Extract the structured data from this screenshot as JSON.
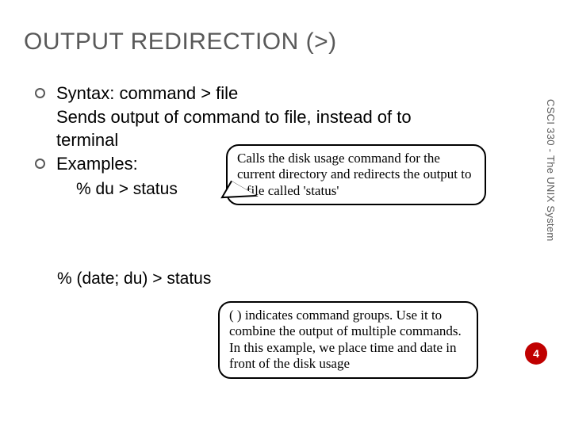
{
  "title": "OUTPUT REDIRECTION (>)",
  "bullets": {
    "syntax": "Syntax: command > file",
    "syntax_desc1": "Sends output of command to file, instead of to",
    "syntax_desc2": "terminal",
    "examples_label": "Examples:"
  },
  "examples": {
    "ex1": "% du > status",
    "ex2": "% (date; du) > status"
  },
  "callouts": {
    "c1": "Calls the disk usage command for the current directory and redirects the output to a file called 'status'",
    "c2": "( ) indicates command groups.  Use it to combine the output of multiple commands.  In this example, we place time and date in front of the disk usage"
  },
  "side_label": "CSCI 330 - The UNIX System",
  "page_number": "4"
}
